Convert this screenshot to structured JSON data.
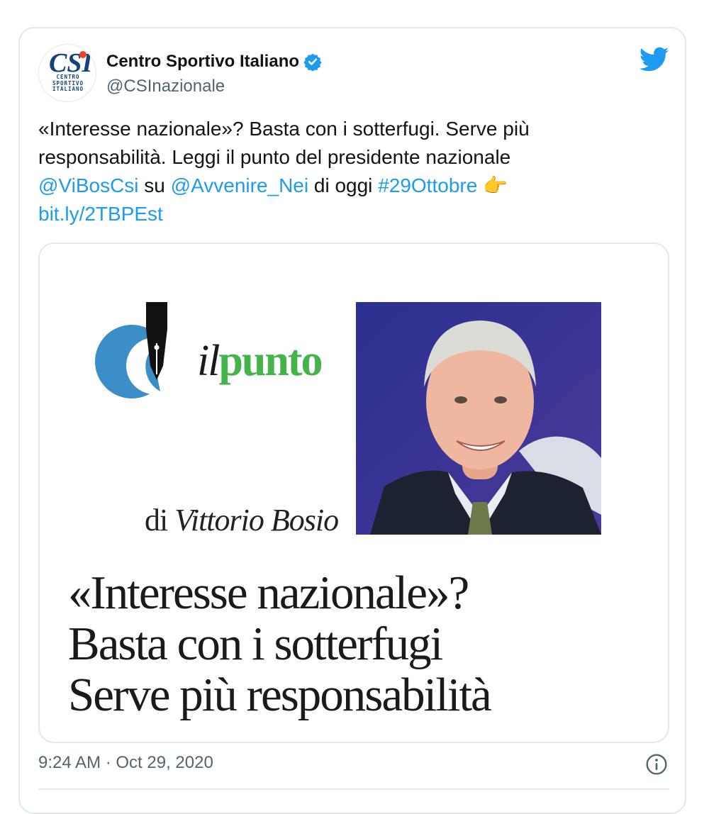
{
  "account": {
    "display_name": "Centro Sportivo Italiano",
    "handle": "@CSInazionale",
    "avatar_text": [
      "CENTRO",
      "SPORTIVO",
      "ITALIANO"
    ],
    "avatar_monogram": "CSI",
    "verified": true
  },
  "tweet": {
    "text_line1": "«Interesse nazionale»? Basta con i sotterfugi. Serve più",
    "text_line2": "responsabilità. Leggi il punto del presidente nazionale",
    "mention1": "@ViBosCsi",
    "word_su": " su ",
    "mention2": "@Avvenire_Nei",
    "word_di_oggi": " di oggi ",
    "hashtag": "#29Ottobre",
    "emoji": "👉",
    "url": "bit.ly/2TBPEst",
    "timestamp": "9:24 AM · Oct 29, 2020"
  },
  "media": {
    "logo_il": "il",
    "logo_punto": "punto",
    "byline_prefix": "di ",
    "byline_author": "Vittorio Bosio",
    "headline_lines": [
      "«Interesse nazionale»?",
      "Basta con i sotterfugi",
      "Serve più responsabilità"
    ]
  },
  "icons": {
    "platform": "twitter-bird-icon",
    "verified": "verified-badge-icon",
    "info": "info-icon"
  },
  "colors": {
    "link": "#1d9bf0",
    "brand_twitter": "#1d9bf0",
    "logo_green": "#43b34a",
    "logo_blue": "#3b8fc6"
  }
}
